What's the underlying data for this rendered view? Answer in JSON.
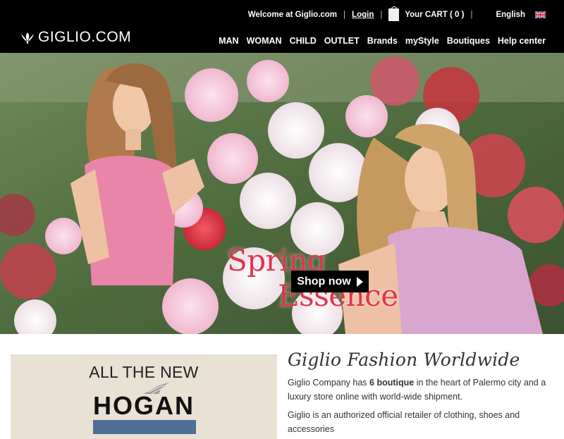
{
  "brand": {
    "logo_text": "GIGLIO.COM"
  },
  "topbar": {
    "welcome": "Welcome at Giglio.com",
    "login": "Login",
    "cart": "Your CART ( 0 )",
    "language": "English"
  },
  "nav": [
    "MAN",
    "WOMAN",
    "CHILD",
    "OUTLET",
    "Brands",
    "myStyle",
    "Boutiques",
    "Help center"
  ],
  "hero": {
    "title_line1": "Spring",
    "title_line2": "Essence",
    "cta": "Shop now"
  },
  "promo": {
    "line1": "ALL THE NEW",
    "brand": "HOGAN"
  },
  "about": {
    "heading": "Giglio Fashion Worldwide",
    "p1_before": "Giglio Company has ",
    "p1_bold": "6 boutique",
    "p1_after": " in the heart of Palermo city and a luxury store online with world-wide shipment.",
    "p2": "Giglio is an authorized official retailer of clothing, shoes and accessories"
  },
  "colors": {
    "header_bg": "#000000",
    "hero_title": "#e0354b",
    "promo_bg": "#e8e1d4"
  }
}
